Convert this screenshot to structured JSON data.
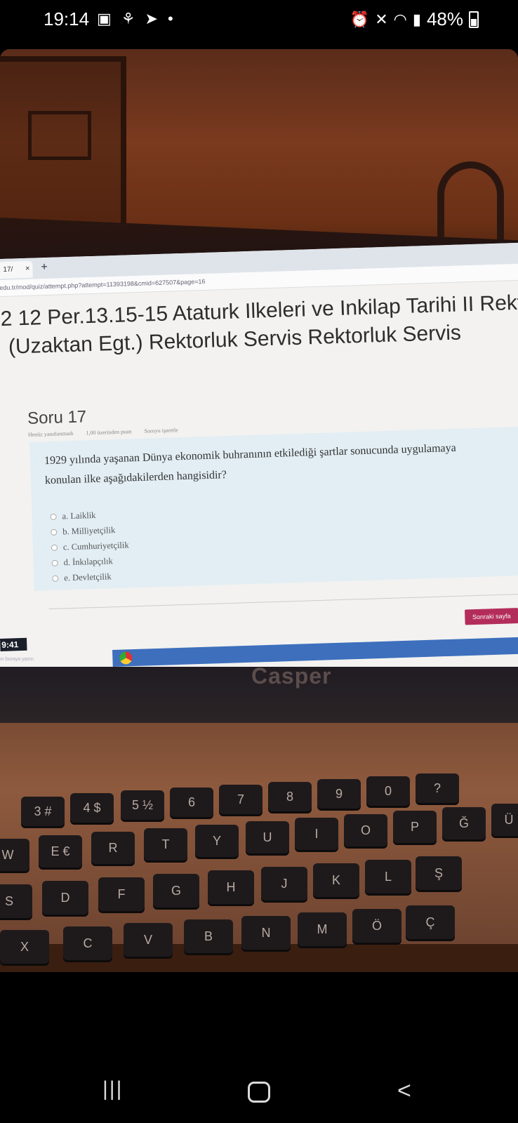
{
  "status_bar": {
    "time": "19:14",
    "left_icons": [
      "image-icon",
      "usb-icon",
      "telegram-icon",
      "dot-icon"
    ],
    "right_icons": [
      "alarm-icon",
      "mute-icon",
      "wifi-icon",
      "signal-icon"
    ],
    "battery": "48%"
  },
  "browser": {
    "tab_label": "17/",
    "tab_close": "×",
    "new_tab": "+",
    "url": "edu.tr/mod/quiz/attempt.php?attempt=11393198&cmid=627507&page=16"
  },
  "quiz": {
    "course_title_line1": "2 12 Per.13.15-15 Ataturk Ilkeleri ve Inkilap Tarihi II Rekt",
    "course_title_line2": "(Uzaktan Egt.) Rektorluk Servis Rektorluk Servis",
    "question_label": "Soru 17",
    "meta": [
      "Henüz yanıtlanmadı",
      "1,00 üzerinden puan",
      "Soruyu işaretle"
    ],
    "question_text": "1929 yılında yaşanan Dünya ekonomik buhranının etkilediği şartlar sonucunda uygulamaya konulan ilke aşağıdakilerden hangisidir?",
    "options": [
      "a. Laiklik",
      "b. Milliyetçilik",
      "c. Cumhuriyetçilik",
      "d. İnkılapçılık",
      "e. Devletçilik"
    ],
    "next_button": "Sonraki sayfa"
  },
  "taskbar": {
    "clock": "9:41",
    "search_hint": "ın buraya yazın"
  },
  "laptop": {
    "brand": "Casper",
    "keys": {
      "row_numbers": [
        "3 #",
        "4 $",
        "5 ½",
        "6",
        "7",
        "8",
        "9",
        "0",
        "?"
      ],
      "row_top": [
        "W",
        "E €",
        "R",
        "T",
        "Y",
        "U",
        "I",
        "O",
        "P",
        "Ğ",
        "Ü"
      ],
      "row_home": [
        "S",
        "D",
        "F",
        "G",
        "H",
        "J",
        "K",
        "L",
        "Ş"
      ],
      "row_bottom": [
        "X",
        "C",
        "V",
        "B",
        "N",
        "M",
        "Ö",
        "Ç"
      ]
    }
  },
  "nav_bar": {
    "recent": "|||",
    "home": "home",
    "back": "<"
  }
}
